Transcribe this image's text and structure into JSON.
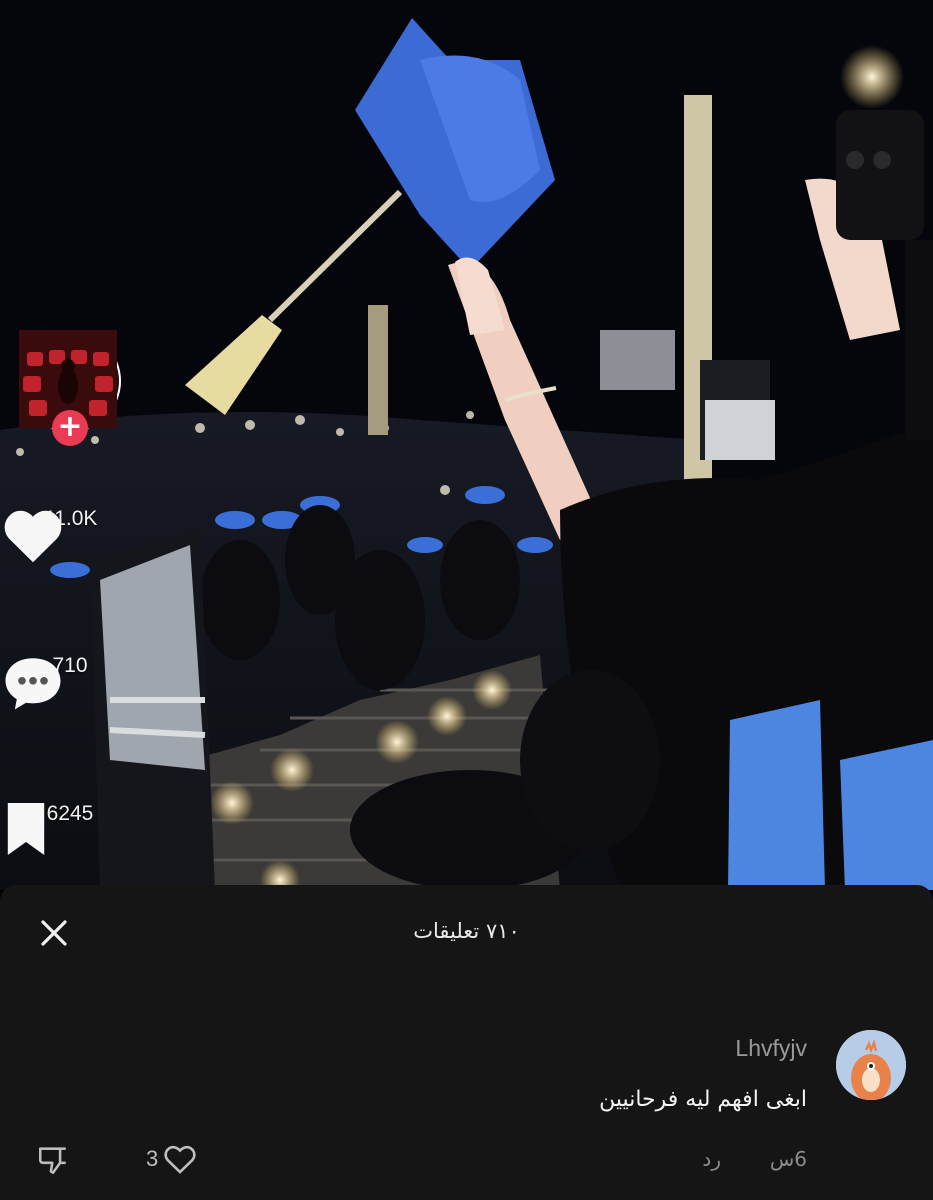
{
  "rail": {
    "likes_count": "41.0K",
    "comments_count": "710",
    "saves_count": "6245"
  },
  "comments_sheet": {
    "title": "٧١٠ تعليقات"
  },
  "comment": {
    "username": "Lhvfyjv",
    "text": "ابغى افهم ليه فرحانيين",
    "time": "6س",
    "reply_label": "رد",
    "like_count": "3"
  },
  "colors": {
    "accent_red": "#ea3b55",
    "sheet_bg": "#151515",
    "gown_blue": "#3a6fd8"
  },
  "icons": {
    "close": "close-icon",
    "heart": "heart-icon",
    "comment": "comment-bubble-icon",
    "save": "bookmark-icon",
    "dislike": "dislike-icon"
  }
}
